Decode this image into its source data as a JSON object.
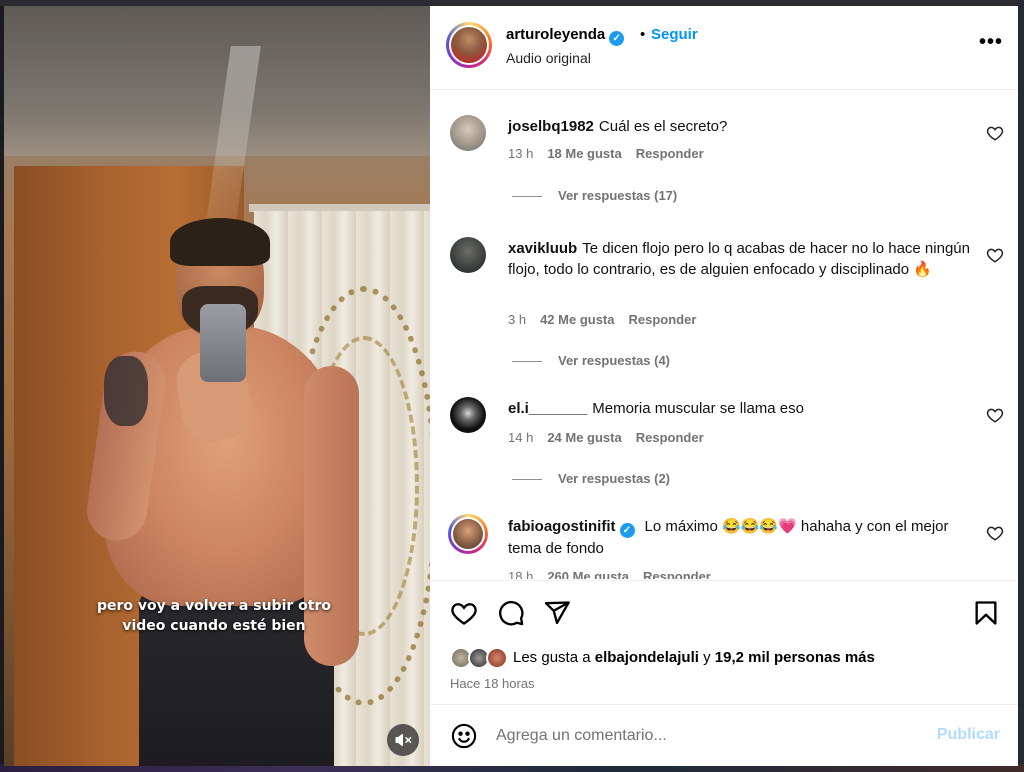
{
  "video": {
    "caption_line1": "pero voy a volver a subir otro",
    "caption_line2": "video cuando esté bien",
    "mute_icon": "speaker-muted-icon"
  },
  "header": {
    "username": "arturoleyenda",
    "verified": true,
    "separator": "•",
    "follow_label": "Seguir",
    "audio": "Audio original",
    "more_label": "•••"
  },
  "comments": [
    {
      "user": "joselbq1982",
      "verified": false,
      "text": "Cuál es el secreto?",
      "time": "13 h",
      "likes": "18 Me gusta",
      "reply_label": "Responder",
      "view_replies": "Ver respuestas (17)"
    },
    {
      "user": "xavikluub",
      "verified": false,
      "text": "Te dicen flojo pero lo q acabas de hacer no lo hace ningún flojo, todo lo contrario, es de alguien enfocado y disciplinado 🔥",
      "time": "3 h",
      "likes": "42 Me gusta",
      "reply_label": "Responder",
      "view_replies": "Ver respuestas (4)"
    },
    {
      "user": "el.i_______",
      "verified": false,
      "text": "Memoria muscular se llama eso",
      "time": "14 h",
      "likes": "24 Me gusta",
      "reply_label": "Responder",
      "view_replies": "Ver respuestas (2)"
    },
    {
      "user": "fabioagostinifit",
      "verified": true,
      "text": "Lo máximo 😂😂😂💗 hahaha y con el mejor tema de fondo",
      "time": "18 h",
      "likes": "260 Me gusta",
      "reply_label": "Responder"
    }
  ],
  "actions": {
    "like_icon": "heart-icon",
    "comment_icon": "comment-bubble-icon",
    "share_icon": "send-icon",
    "save_icon": "bookmark-icon"
  },
  "likes": {
    "prefix": "Les gusta a ",
    "user": "elbajondelajuli",
    "middle": " y ",
    "count": "19,2 mil personas más"
  },
  "time_ago": "Hace 18 horas",
  "add_comment": {
    "placeholder": "Agrega un comentario...",
    "publish_label": "Publicar"
  },
  "colors": {
    "accent": "#0095f6",
    "verified": "#1d9bf0",
    "muted_text": "#737373",
    "publish_disabled": "#b3dbff"
  }
}
